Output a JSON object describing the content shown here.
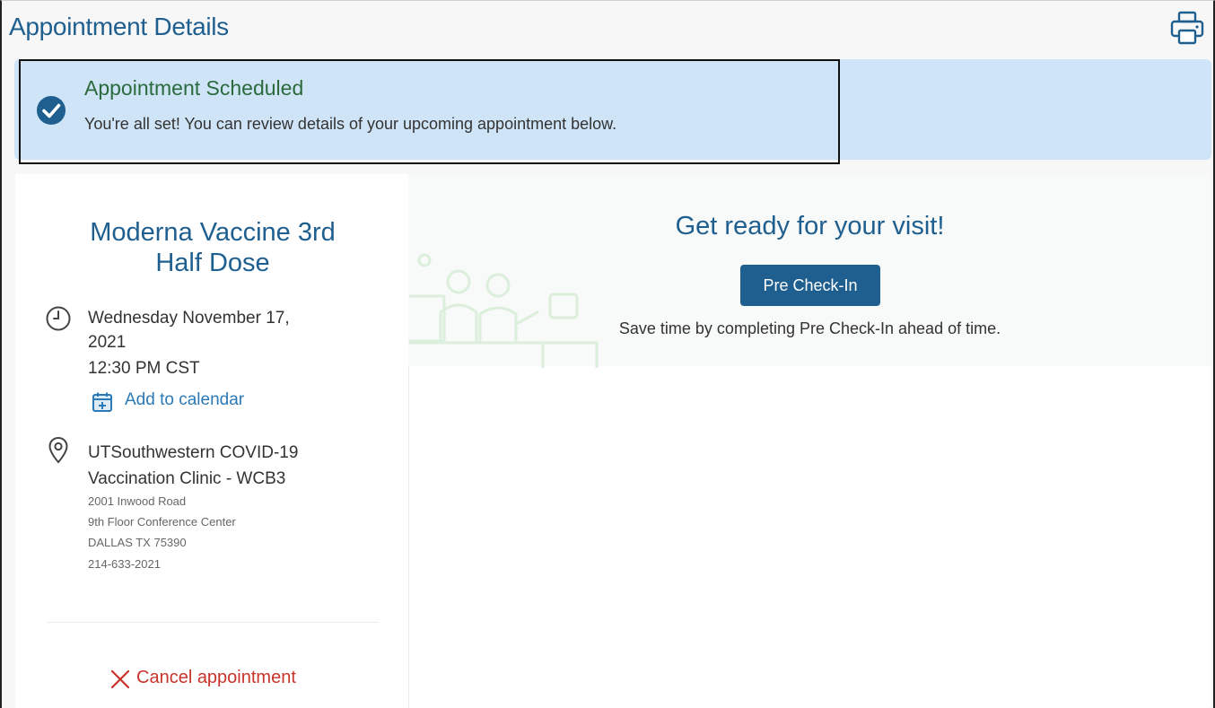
{
  "page": {
    "title": "Appointment Details",
    "print_icon": "printer-icon"
  },
  "banner": {
    "icon": "check-circle-icon",
    "title": "Appointment Scheduled",
    "message": "You're all set! You can review details of your upcoming appointment below."
  },
  "appointment": {
    "title_line1": "Moderna Vaccine 3rd",
    "title_line2": "Half Dose",
    "time_icon": "clock-icon",
    "date_line1": "Wednesday November 17,",
    "date_line2": "2021",
    "time": "12:30 PM CST",
    "add_to_calendar": "Add to calendar",
    "calendar_icon": "calendar-icon",
    "location_icon": "map-pin-icon",
    "clinic_line1": "UTSouthwestern COVID-19",
    "clinic_line2": "Vaccination Clinic - WCB3",
    "address_line1": "2001 Inwood Road",
    "address_line2": "9th Floor Conference Center",
    "address_line3": "DALLAS TX 75390",
    "phone": "214-633-2021",
    "cancel_label": "Cancel appointment",
    "cancel_icon": "x-icon"
  },
  "visit": {
    "title": "Get ready for your visit!",
    "precheck_button": "Pre Check-In",
    "precheck_text": "Save time by completing Pre Check-In ahead of time."
  },
  "colors": {
    "heading_blue": "#1f5f8f",
    "banner_bg": "#cfe5f7",
    "success_green": "#2a6a3c",
    "link_blue": "#2b79b6",
    "cancel_red": "#c8332b"
  }
}
